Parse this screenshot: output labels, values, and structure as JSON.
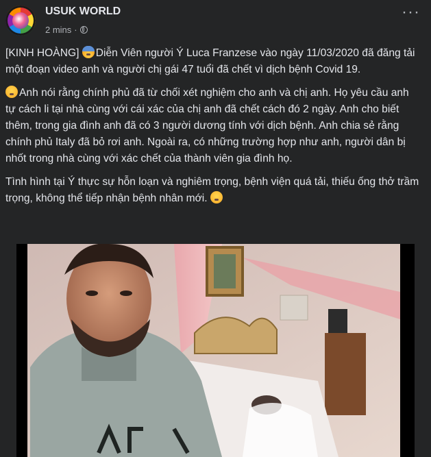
{
  "page": {
    "name": "USUK WORLD",
    "time": "2 mins",
    "separator": "·",
    "more_label": "···"
  },
  "post": {
    "p1_prefix": "[KINH HOÀNG] ",
    "p1_text": "Diễn Viên người Ý Luca Franzese vào ngày 11/03/2020 đã đăng tải một đoạn video anh và người chị gái 47 tuổi đã chết vì dịch bệnh Covid 19.",
    "p2_text": "Anh nói rằng chính phủ đã từ chối xét nghiệm cho anh và chị anh. Họ yêu cầu anh tự cách li tại nhà cùng với cái xác của chị anh đã chết cách đó 2 ngày. Anh cho biết thêm, trong gia đình anh đã có 3 người dương tính với dịch bệnh. Anh chia sẻ rằng chính phủ Italy đã bỏ rơi anh. Ngoài ra, có những trường hợp như anh, người dân bị nhốt trong nhà cùng với xác chết của thành viên gia đình họ.",
    "p3_text": "Tình hình tại Ý thực sự hỗn loạn và nghiêm trọng, bệnh viện quá tải, thiếu ống thở trầm trọng, không thể tiếp nhận bệnh nhân mới."
  },
  "icons": {
    "globe": "globe-icon",
    "fearful": "fearful-face-icon",
    "tired": "tired-face-icon",
    "sad": "sad-face-icon"
  },
  "colors": {
    "post_bg": "#242526",
    "text": "#e4e6eb",
    "secondary": "#b0b3b8"
  }
}
